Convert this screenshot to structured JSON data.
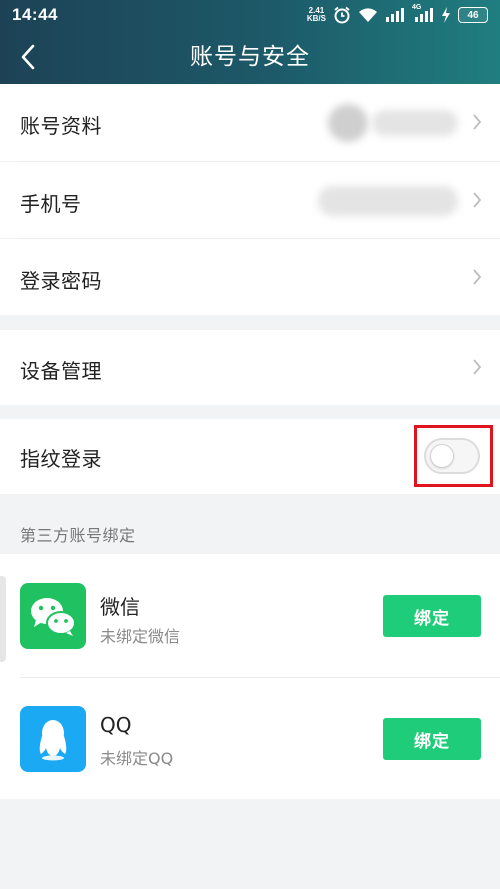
{
  "status_bar": {
    "time": "14:44",
    "net_speed_value": "2.41",
    "net_speed_unit": "KB/S",
    "signal_label": "4G",
    "battery": "46"
  },
  "header": {
    "title": "账号与安全",
    "back_icon": "chevron-left-icon"
  },
  "account_section": {
    "items": [
      {
        "label": "账号资料"
      },
      {
        "label": "手机号"
      },
      {
        "label": "登录密码"
      }
    ]
  },
  "device_section": {
    "label": "设备管理"
  },
  "fingerprint": {
    "label": "指纹登录",
    "enabled": false
  },
  "third_party": {
    "section_label": "第三方账号绑定",
    "accounts": [
      {
        "name": "微信",
        "status": "未绑定微信",
        "button": "绑定",
        "icon": "wechat-icon",
        "color": "#1fc160"
      },
      {
        "name": "QQ",
        "status": "未绑定QQ",
        "button": "绑定",
        "icon": "qq-icon",
        "color": "#1aa9f2"
      }
    ]
  },
  "colors": {
    "header_start": "#1d4256",
    "header_end": "#1f7e80",
    "bind_button": "#1fcc79",
    "highlight": "#e0141e"
  }
}
